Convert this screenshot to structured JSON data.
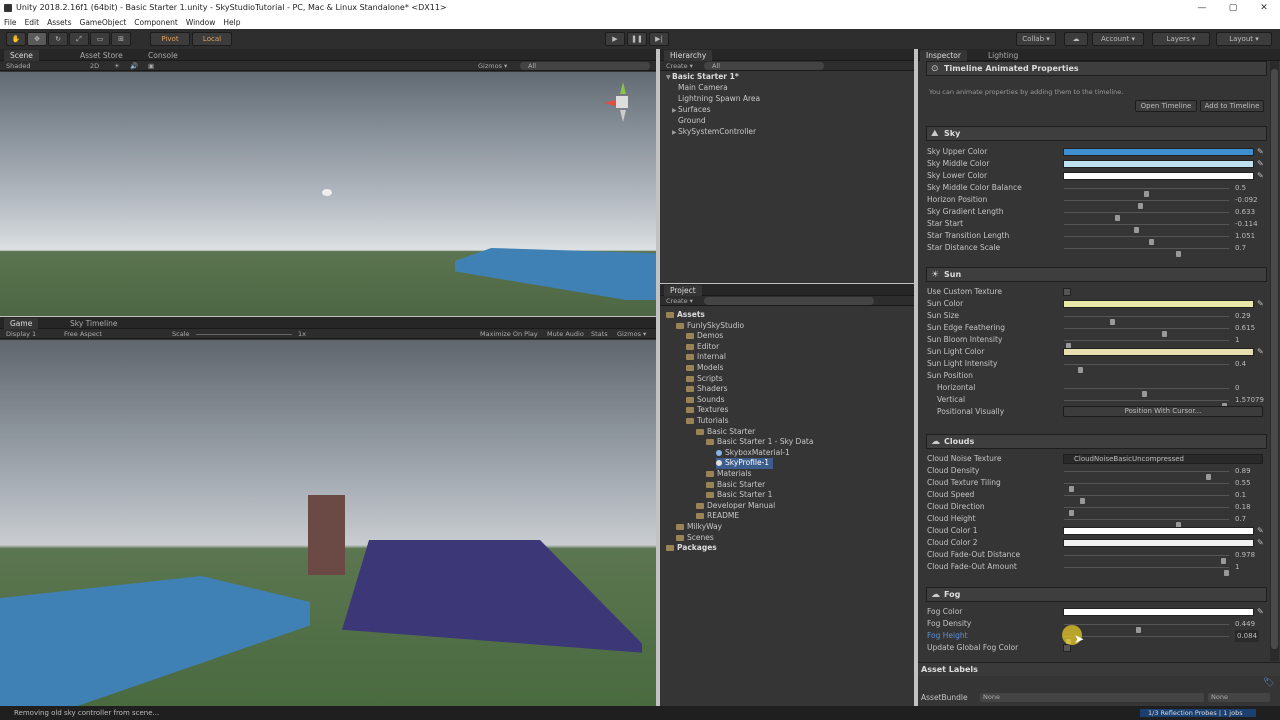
{
  "window": {
    "title": "Unity 2018.2.16f1 (64bit) - Basic Starter 1.unity - SkyStudioTutorial - PC, Mac & Linux Standalone* <DX11>",
    "controls": [
      "—",
      "▢",
      "✕"
    ]
  },
  "menu": [
    "File",
    "Edit",
    "Assets",
    "GameObject",
    "Component",
    "Window",
    "Help"
  ],
  "toolbar": {
    "pivot": "Pivot",
    "local": "Local",
    "collab": "Collab ▾",
    "account": "Account ▾",
    "layers": "Layers ▾",
    "layout": "Layout ▾"
  },
  "scene_view": {
    "tabs": [
      "Scene",
      "Asset Store",
      "Console"
    ],
    "shading": "Shaded",
    "mode2d": "2D",
    "gizmos": "Gizmos ▾",
    "search": "All"
  },
  "game_view": {
    "tabs": [
      "Game",
      "Sky Timeline"
    ],
    "display": "Display 1",
    "aspect": "Free Aspect",
    "scale_label": "Scale",
    "scale_value": "1x",
    "maximize": "Maximize On Play",
    "mute": "Mute Audio",
    "stats": "Stats",
    "gizmos": "Gizmos ▾"
  },
  "hierarchy": {
    "tab": "Hierarchy",
    "create": "Create ▾",
    "search": "All",
    "scene": "Basic Starter 1*",
    "items": [
      "Main Camera",
      "Lightning Spawn Area",
      "Surfaces",
      "Ground",
      "SkySystemController"
    ]
  },
  "project": {
    "tab": "Project",
    "create": "Create ▾",
    "tree": [
      {
        "label": "Assets",
        "level": 0,
        "bold": true
      },
      {
        "label": "FunlySkyStudio",
        "level": 1
      },
      {
        "label": "Demos",
        "level": 2
      },
      {
        "label": "Editor",
        "level": 2
      },
      {
        "label": "Internal",
        "level": 2
      },
      {
        "label": "Models",
        "level": 2
      },
      {
        "label": "Scripts",
        "level": 2
      },
      {
        "label": "Shaders",
        "level": 2
      },
      {
        "label": "Sounds",
        "level": 2
      },
      {
        "label": "Textures",
        "level": 2
      },
      {
        "label": "Tutorials",
        "level": 2
      },
      {
        "label": "Basic Starter",
        "level": 3
      },
      {
        "label": "Basic Starter 1 - Sky Data",
        "level": 4
      },
      {
        "label": "SkyboxMaterial-1",
        "level": 5
      },
      {
        "label": "SkyProfile-1",
        "level": 5,
        "selected": true
      },
      {
        "label": "Materials",
        "level": 4
      },
      {
        "label": "Basic Starter",
        "level": 4
      },
      {
        "label": "Basic Starter 1",
        "level": 4
      },
      {
        "label": "Developer Manual",
        "level": 3
      },
      {
        "label": "README",
        "level": 3
      },
      {
        "label": "MilkyWay",
        "level": 1
      },
      {
        "label": "Scenes",
        "level": 1
      },
      {
        "label": "Packages",
        "level": 0,
        "bold": true
      }
    ]
  },
  "inspector": {
    "tabs": [
      "Inspector",
      "Lighting"
    ],
    "timeline": {
      "title": "Timeline Animated Properties",
      "hint": "You can animate properties by adding them to the timeline.",
      "open_btn": "Open Timeline",
      "add_btn": "Add to Timeline"
    },
    "sky": {
      "title": "Sky",
      "upper": "Sky Upper Color",
      "middle": "Sky Middle Color",
      "lower": "Sky Lower Color",
      "balance": "Sky Middle Color Balance",
      "balance_v": "0.5",
      "horizon": "Horizon Position",
      "horizon_v": "-0.092",
      "gradient": "Sky Gradient Length",
      "gradient_v": "0.633",
      "star_start": "Star Start",
      "star_start_v": "-0.114",
      "star_trans": "Star Transition Length",
      "star_trans_v": "1.051",
      "star_dist": "Star Distance Scale",
      "star_dist_v": "0.7"
    },
    "sun": {
      "title": "Sun",
      "custom_tex": "Use Custom Texture",
      "color": "Sun Color",
      "size": "Sun Size",
      "size_v": "0.29",
      "edge": "Sun Edge Feathering",
      "edge_v": "0.615",
      "bloom": "Sun Bloom Intensity",
      "bloom_v": "1",
      "light_color": "Sun Light Color",
      "light_int": "Sun Light Intensity",
      "light_int_v": "0.4",
      "position": "Sun Position",
      "horizontal": "Horizontal",
      "horizontal_v": "0",
      "vertical": "Vertical",
      "vertical_v": "1.57079",
      "pos_vis": "Positional Visually",
      "pos_btn": "Position With Cursor..."
    },
    "clouds": {
      "title": "Clouds",
      "noise": "Cloud Noise Texture",
      "noise_v": "CloudNoiseBasicUncompressed",
      "density": "Cloud Density",
      "density_v": "0.89",
      "tiling": "Cloud Texture Tiling",
      "tiling_v": "0.55",
      "speed": "Cloud Speed",
      "speed_v": "0.1",
      "direction": "Cloud Direction",
      "direction_v": "0.18",
      "height": "Cloud Height",
      "height_v": "0.7",
      "color1": "Cloud Color 1",
      "color2": "Cloud Color 2",
      "fade_dist": "Cloud Fade-Out Distance",
      "fade_dist_v": "0.978",
      "fade_amt": "Cloud Fade-Out Amount",
      "fade_amt_v": "1"
    },
    "fog": {
      "title": "Fog",
      "color": "Fog Color",
      "density": "Fog Density",
      "density_v": "0.449",
      "height": "Fog Height",
      "height_v": "0.084",
      "update": "Update Global Fog Color"
    },
    "asset_labels": "Asset Labels",
    "asset_bundle": "AssetBundle",
    "bundle_v1": "None",
    "bundle_v2": "None"
  },
  "slider_levels": {
    "balance": 0.5,
    "horizon": 0.46,
    "gradient": 0.32,
    "star_start": 0.44,
    "star_trans": 0.53,
    "star_dist": 0.7,
    "size": 0.29,
    "edge": 0.61,
    "bloom": 0.01,
    "light_int": 0.09,
    "horizontal": 0.49,
    "vertical": 0.99,
    "density": 0.89,
    "tiling": 0.03,
    "speed": 0.1,
    "direction": 0.03,
    "height": 0.7,
    "fade_dist": 0.98,
    "fade_amt": 1.0,
    "fog_density": 0.45,
    "fog_height": 0.01
  },
  "colors": {
    "sky_upper": "#3f8fcf",
    "sky_middle": "#bfe2f0",
    "sky_lower": "#ffffff",
    "sun": "#e8e8a8",
    "sun_light": "#e8dfb0",
    "cloud1": "#ffffff",
    "cloud2": "#f0f0f0",
    "fog": "#ffffff"
  },
  "status": {
    "message": "Removing old sky controller from scene...",
    "progress": "1/3 Reflection Probes | 1 jobs"
  }
}
